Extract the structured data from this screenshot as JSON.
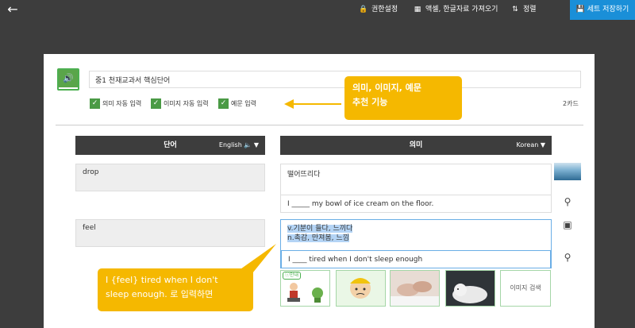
{
  "topbar": {
    "back_icon": "arrow-left",
    "permissions_label": "권한설정",
    "import_label": "액셀, 한글자료 가져오기",
    "sort_label": "정렬",
    "save_label": "세트 저장하기",
    "accent_color": "#1a8fd8"
  },
  "set": {
    "title": "중1 천재교과서 핵심단어",
    "card_count": "2카드"
  },
  "options": {
    "auto_meaning": "의미 자동 입력",
    "auto_image": "이미지 자동 입력",
    "example_input": "예문 입력"
  },
  "columns": {
    "word_header": "단어",
    "word_lang": "English",
    "meaning_header": "의미",
    "meaning_lang": "Korean"
  },
  "cards": [
    {
      "word": "drop",
      "meaning": "떨어뜨리다",
      "example": "I _____ my bowl of ice cream on the floor."
    },
    {
      "word": "feel",
      "meaning_line1": "v.기분이 들다, 느끼다",
      "meaning_line2": "n.촉감, 만져봄, 느낌",
      "example": "I ____ tired when I don't sleep enough"
    }
  ],
  "image_search": {
    "badge": "안내",
    "search_label": "이미지 검색"
  },
  "callouts": {
    "top_line1": "의미, 이미지, 예문",
    "top_line2": "추천 기능",
    "bottom_line1": "I {feel} tired when I don't",
    "bottom_line2": "sleep enough. 로 입력하면"
  }
}
